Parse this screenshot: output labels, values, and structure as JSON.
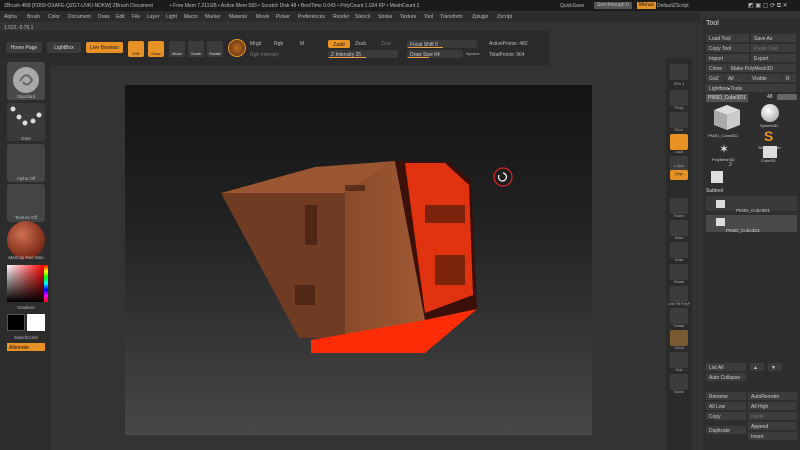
{
  "titlebar": {
    "title": "ZBrush 4R8 [FD00-OXAFE-QZGT-UVKI-NDKW]   ZBrush Document",
    "mem": "• Free Mem 7.211GB • Active Mem 583 • Scratch Disk 48 • BoolTime 0.043 • PolyCount 1.024 KP • MeshCount 2",
    "quicksave": "QuickSave",
    "seethrough": "See-through  0",
    "menus": "Menus",
    "script": "DefaultZScript"
  },
  "menubar": [
    "Alpha",
    "Brush",
    "Color",
    "Document",
    "Draw",
    "Edit",
    "File",
    "Layer",
    "Light",
    "Macro",
    "Marker",
    "Material",
    "Movie",
    "Picker",
    "Preferences",
    "Render",
    "Stencil",
    "Stroke",
    "Texture",
    "Tool",
    "Transform",
    "Zplugin",
    "Zscript"
  ],
  "coords": "1.022,-0.75,1",
  "toolbar": {
    "home": "Home Page",
    "lightbox": "LightBox",
    "live_boolean": "Live Boolean",
    "edit": "Edit",
    "draw": "Draw",
    "move": "Move",
    "scale": "Scale",
    "rotate": "Rotate",
    "mrgb": "Mrgb",
    "rgb": "Rgb",
    "m": "M",
    "rgb_intensity": "Rgb Intensity",
    "zadd": "Zadd",
    "zsub": "Zsub",
    "zcut": "Zcut",
    "z_intensity": "Z Intensity 25",
    "focal": "Focal Shift 0",
    "draw_size": "Draw Size 64",
    "dynamic": "Dynamic",
    "active_points": "ActivePoints: 482",
    "total_points": "TotalPoints: 964"
  },
  "left": {
    "standard": "Standard",
    "dots": "Dots",
    "alpha": "Alpha Off",
    "texture": "Texture Off",
    "material": "MatCap Red Wax",
    "gradient": "Gradient",
    "switch": "SwitchColor",
    "alternate": "Alternate"
  },
  "shelf": [
    "SPix 3",
    "Persp",
    "Floor",
    "Local",
    "L.Sym",
    "Qxyz",
    "Frame",
    "Move",
    "Scale",
    "Rotate",
    "Line Fill PolyF",
    "Transp",
    "Ghost",
    "Solo",
    "Xpose"
  ],
  "tool": {
    "title": "Tool",
    "load": "Load Tool",
    "saveas": "Save As",
    "copy": "Copy Tool",
    "paste": "Paste Tool",
    "import": "Import",
    "export": "Export",
    "clone": "Clone",
    "make": "Make PolyMesh3D",
    "goz": "GoZ",
    "all": "All",
    "visible": "Visible",
    "r": "R",
    "lightbox_tools": "Lightbox▸Tools",
    "current": "PM3D_Cube3D1",
    "current_n": "48",
    "items": [
      "PM3D_Cube3D1",
      "Sphere3D",
      "SimpleBrush",
      "PolyMesh3D",
      "Cube3D"
    ],
    "count2": "2",
    "subtool": "Subtool",
    "sub1": "PM3D_Cube3D1",
    "sub2": "PM3D_Cube3D1",
    "listall": "List All",
    "autocollapse": "Auto Collapse",
    "rename": "Rename",
    "autoreorder": "AutoReorder",
    "alllow": "All Low",
    "allhigh": "All High",
    "copy2": "Copy",
    "paste2": "Paste",
    "append": "Append",
    "duplicate": "Duplicate",
    "insert": "Insert"
  }
}
